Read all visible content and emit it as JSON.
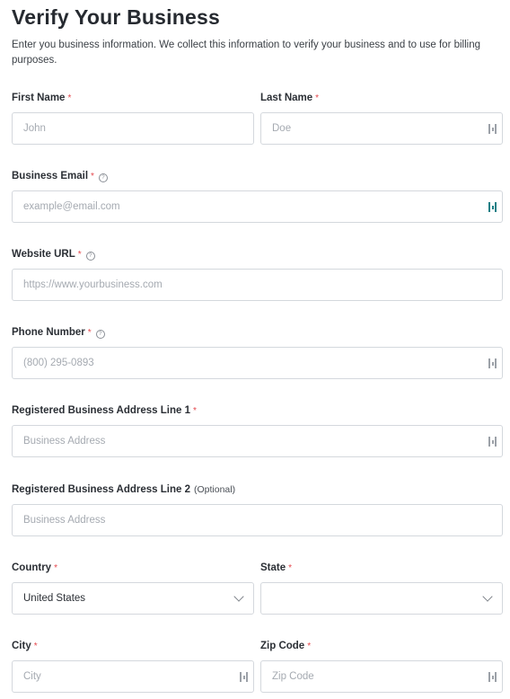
{
  "page": {
    "title": "Verify Your Business",
    "description": "Enter you business information. We collect this information to verify your business and to use for billing purposes."
  },
  "fields": {
    "first_name": {
      "label": "First Name",
      "required": "*",
      "placeholder": "John"
    },
    "last_name": {
      "label": "Last Name",
      "required": "*",
      "placeholder": "Doe"
    },
    "business_email": {
      "label": "Business Email",
      "required": "*",
      "placeholder": "example@email.com"
    },
    "website_url": {
      "label": "Website URL",
      "required": "*",
      "placeholder": "https://www.yourbusiness.com"
    },
    "phone_number": {
      "label": "Phone Number",
      "required": "*",
      "placeholder": "(800) 295-0893"
    },
    "address_line1": {
      "label": "Registered Business Address Line 1",
      "required": "*",
      "placeholder": "Business Address"
    },
    "address_line2": {
      "label": "Registered Business Address Line 2",
      "optional": "(Optional)",
      "placeholder": "Business Address"
    },
    "country": {
      "label": "Country",
      "required": "*",
      "value": "United States"
    },
    "state": {
      "label": "State",
      "required": "*",
      "value": ""
    },
    "city": {
      "label": "City",
      "required": "*",
      "placeholder": "City"
    },
    "zip_code": {
      "label": "Zip Code",
      "required": "*",
      "placeholder": "Zip Code"
    }
  },
  "icons": {
    "help": "help-circle-icon",
    "password_manager": "password-manager-icon",
    "dropdown": "chevron-down-icon"
  },
  "colors": {
    "required": "#e5484d",
    "border": "#d4d8dd",
    "password_manager_active": "#1a7f85"
  }
}
